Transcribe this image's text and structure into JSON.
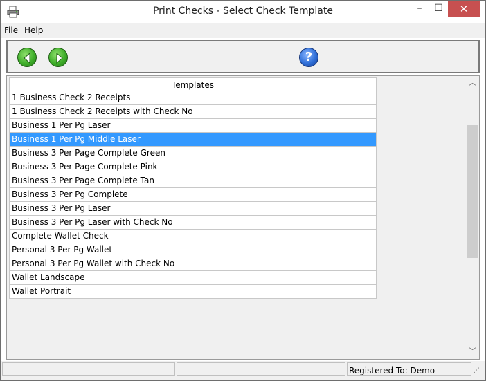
{
  "window": {
    "title": "Print Checks - Select Check Template"
  },
  "titlebar_controls": {
    "minimize": "–",
    "maximize": "☐",
    "close": "✕"
  },
  "menu": {
    "items": [
      "File",
      "Help"
    ]
  },
  "toolbar": {
    "back_icon": "green-left-arrow-icon",
    "forward_icon": "green-right-arrow-icon",
    "help_icon": "blue-question-mark-icon",
    "help_glyph": "?"
  },
  "templates": {
    "header": "Templates",
    "selected_index": 3,
    "rows": [
      "1 Business Check 2 Receipts",
      "1 Business Check 2 Receipts with Check No",
      "Business 1 Per Pg Laser",
      "Business 1 Per Pg Middle Laser",
      "Business 3 Per Page Complete Green",
      "Business 3 Per Page Complete Pink",
      "Business 3 Per Page Complete Tan",
      "Business 3 Per Pg Complete",
      "Business 3 Per Pg Laser",
      "Business 3 Per Pg Laser with Check No",
      "Complete Wallet Check",
      "Personal 3 Per Pg Wallet",
      "Personal 3 Per Pg Wallet with Check No",
      "Wallet Landscape",
      "Wallet Portrait"
    ]
  },
  "scrollbar": {
    "up": "︿",
    "down": "﹀"
  },
  "status": {
    "registered": "Registered To: Demo",
    "grip": "⋰"
  },
  "colors": {
    "selection": "#3399ff",
    "close_button": "#c75050"
  }
}
